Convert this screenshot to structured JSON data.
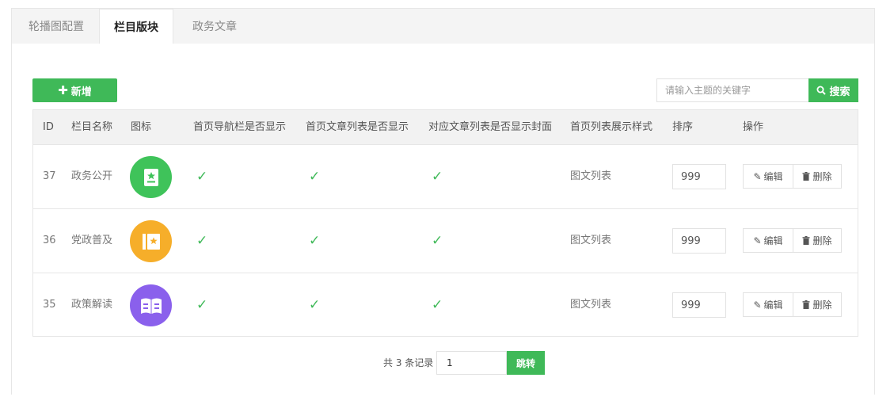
{
  "tabs": [
    {
      "label": "轮播图配置"
    },
    {
      "label": "栏目版块"
    },
    {
      "label": "政务文章"
    }
  ],
  "toolbar": {
    "add_label": "新增",
    "search_placeholder": "请输入主题的关键字",
    "search_label": "搜索"
  },
  "table": {
    "headers": [
      "ID",
      "栏目名称",
      "图标",
      "首页导航栏是否显示",
      "首页文章列表是否显示",
      "对应文章列表是否显示封面",
      "首页列表展示样式",
      "排序",
      "操作"
    ],
    "rows": [
      {
        "id": "37",
        "name": "政务公开",
        "icon": "notepad-star-icon",
        "icon_color": "#3fc35a",
        "nav_show": "✓",
        "list_show": "✓",
        "cover_show": "✓",
        "style": "图文列表",
        "sort": "999"
      },
      {
        "id": "36",
        "name": "党政普及",
        "icon": "book-star-icon",
        "icon_color": "#f6ae2a",
        "nav_show": "✓",
        "list_show": "✓",
        "cover_show": "✓",
        "style": "图文列表",
        "sort": "999"
      },
      {
        "id": "35",
        "name": "政策解读",
        "icon": "open-book-icon",
        "icon_color": "#8a60ec",
        "nav_show": "✓",
        "list_show": "✓",
        "cover_show": "✓",
        "style": "图文列表",
        "sort": "999"
      }
    ],
    "edit_label": "编辑",
    "delete_label": "删除"
  },
  "pager": {
    "total_text": "共 3 条记录",
    "page_value": "1",
    "jump_label": "跳转"
  },
  "colors": {
    "accent": "#3fb958"
  }
}
